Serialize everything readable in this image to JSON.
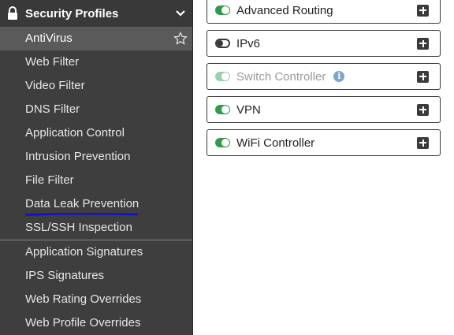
{
  "sidebar": {
    "header": {
      "title": "Security Profiles"
    },
    "items": [
      {
        "label": "AntiVirus"
      },
      {
        "label": "Web Filter"
      },
      {
        "label": "Video Filter"
      },
      {
        "label": "DNS Filter"
      },
      {
        "label": "Application Control"
      },
      {
        "label": "Intrusion Prevention"
      },
      {
        "label": "File Filter"
      },
      {
        "label": "Data Leak Prevention"
      },
      {
        "label": "SSL/SSH Inspection"
      },
      {
        "label": "Application Signatures"
      },
      {
        "label": "IPS Signatures"
      },
      {
        "label": "Web Rating Overrides"
      },
      {
        "label": "Web Profile Overrides"
      }
    ]
  },
  "features": [
    {
      "label": "Advanced Routing",
      "state": "on"
    },
    {
      "label": "IPv6",
      "state": "off"
    },
    {
      "label": "Switch Controller",
      "state": "disabled"
    },
    {
      "label": "VPN",
      "state": "on"
    },
    {
      "label": "WiFi Controller",
      "state": "on"
    }
  ],
  "colors": {
    "sidebar_bg": "#3e3e3e",
    "active_item_bg": "#5a5a5a",
    "toggle_on": "#2f9a4a",
    "underline": "#1010c8"
  }
}
